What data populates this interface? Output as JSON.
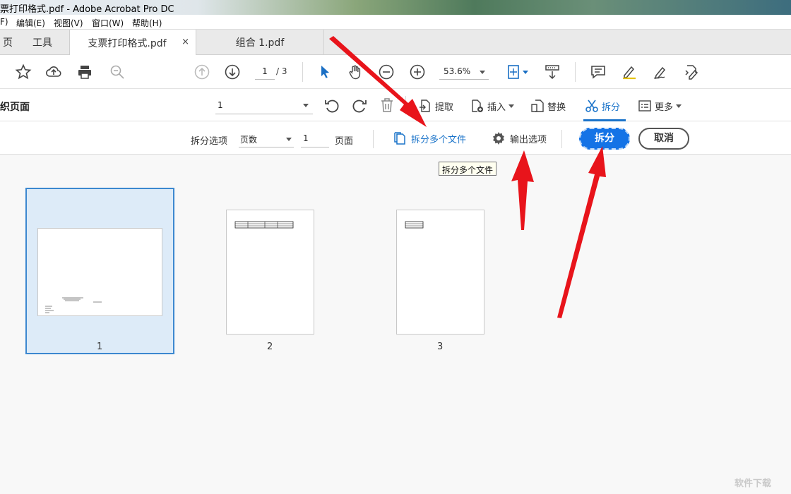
{
  "window": {
    "title": "票打印格式.pdf - Adobe Acrobat Pro DC"
  },
  "menu": [
    "F)",
    "编辑(E)",
    "视图(V)",
    "窗口(W)",
    "帮助(H)"
  ],
  "tabs": {
    "home": "页",
    "tools": "工具",
    "doc1": "支票打印格式.pdf",
    "close": "×",
    "doc2": "组合 1.pdf"
  },
  "toolbar": {
    "page_current": "1",
    "page_total": "/ 3",
    "zoom": "53.6%"
  },
  "organize": {
    "title": "织页面",
    "page_select": "1",
    "extract": "提取",
    "insert": "插入",
    "replace": "替换",
    "split": "拆分",
    "more": "更多"
  },
  "split_bar": {
    "options_label": "拆分选项",
    "mode": "页数",
    "count": "1",
    "unit": "页面",
    "multi_files": "拆分多个文件",
    "output_options": "输出选项",
    "split_button": "拆分",
    "cancel_button": "取消",
    "tooltip": "拆分多个文件"
  },
  "thumbnails": [
    "1",
    "2",
    "3"
  ],
  "colors": {
    "accent": "#1473e6",
    "arrow": "#e8141b",
    "selection": "#ddebf8"
  },
  "watermark": "软件下载"
}
